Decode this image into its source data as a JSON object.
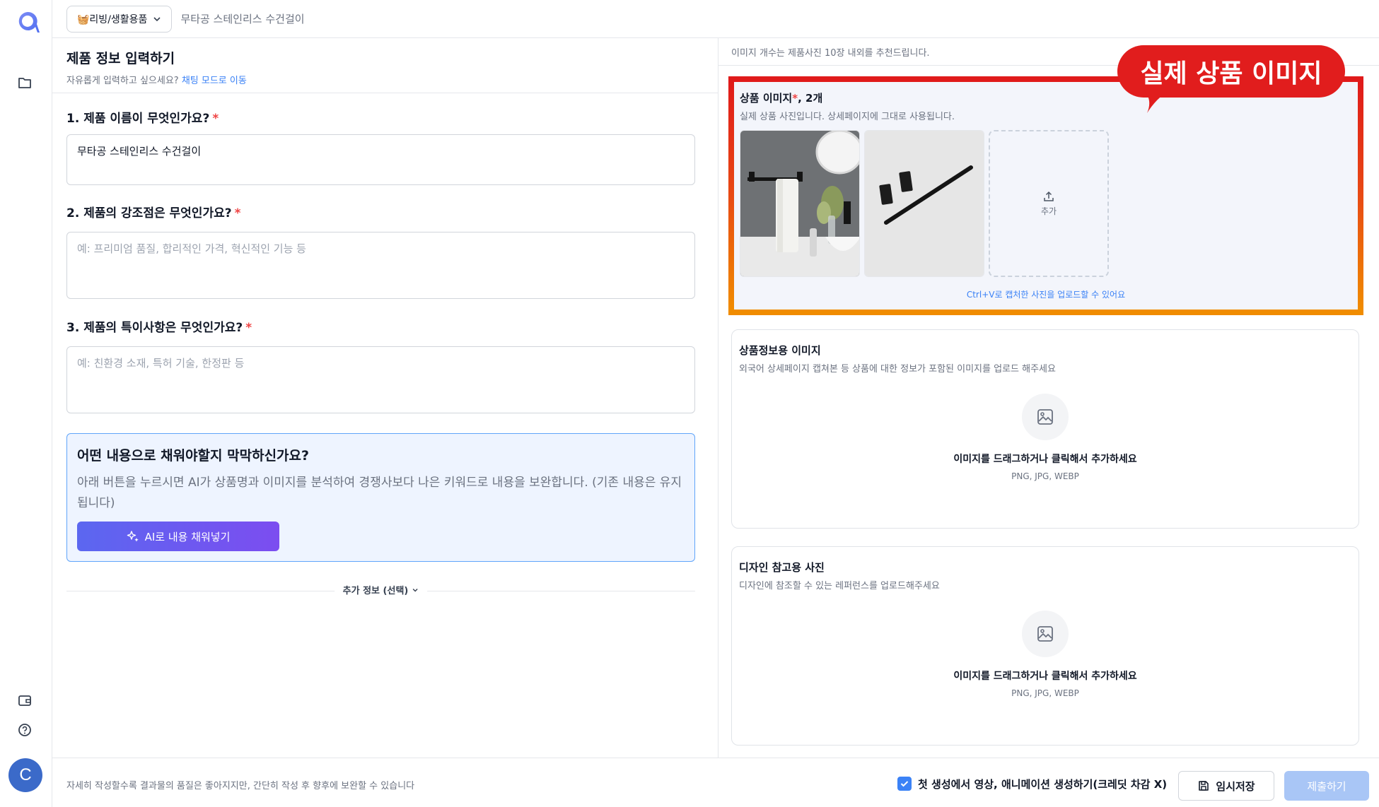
{
  "topbar": {
    "category_label": "🧺리빙/생활용품",
    "breadcrumb": "무타공 스테인리스 수건걸이"
  },
  "left": {
    "title": "제품 정보 입력하기",
    "subtitle_prefix": "자유롭게 입력하고 싶으세요?",
    "subtitle_link": "채팅 모드로 이동",
    "questions": [
      {
        "label": "1. 제품 이름이 무엇인가요?",
        "required": "*",
        "value": "무타공 스테인리스 수건걸이",
        "placeholder": ""
      },
      {
        "label": "2. 제품의 강조점은 무엇인가요?",
        "required": "*",
        "value": "",
        "placeholder": "예: 프리미엄 품질, 합리적인 가격, 혁신적인 기능 등"
      },
      {
        "label": "3. 제품의 특이사항은 무엇인가요?",
        "required": "*",
        "value": "",
        "placeholder": "예: 친환경 소재, 특허 기술, 한정판 등"
      }
    ],
    "ai_box": {
      "heading": "어떤 내용으로 채워야할지 막막하신가요?",
      "text": "아래 버튼을 누르시면 AI가 상품명과 이미지를 분석하여 경쟁사보다 나은 키워드로 내용을 보완합니다. (기존 내용은 유지됩니다)",
      "button": "AI로 내용 채워넣기"
    },
    "more_info": "추가 정보 (선택)"
  },
  "right": {
    "top_note": "이미지 개수는 제품사진 10장 내외를 추천드립니다.",
    "callout": "실제 상품 이미지",
    "product_images": {
      "title": "상품 이미지",
      "required": "*",
      "count": ", 2개",
      "subtitle": "실제 상품 사진입니다. 상세페이지에 그대로 사용됩니다.",
      "add_label": "추가",
      "hint": "Ctrl+V로 캡처한 사진을 업로드할 수 있어요"
    },
    "info_images": {
      "title": "상품정보용 이미지",
      "subtitle": "외국어 상세페이지 캡쳐본 등 상품에 대한 정보가 포함된 이미지를 업로드 해주세요",
      "drop_label": "이미지를 드래그하거나 클릭해서 추가하세요",
      "formats": "PNG, JPG, WEBP"
    },
    "design_images": {
      "title": "디자인 참고용 사진",
      "subtitle": "디자인에 참조할 수 있는 레퍼런스를 업로드해주세요",
      "drop_label": "이미지를 드래그하거나 클릭해서 추가하세요",
      "formats": "PNG, JPG, WEBP"
    }
  },
  "bottom": {
    "message": "자세히 작성할수록 결과물의 품질은 좋아지지만, 간단히 작성 후 향후에 보완할 수 있습니다",
    "checkbox_label": "첫 생성에서 영상, 애니메이션 생성하기(크레딧 차감 X)",
    "checkbox_checked": true,
    "save_label": "임시저장",
    "submit_label": "제출하기"
  },
  "user": {
    "avatar_initial": "C"
  },
  "colors": {
    "accent": "#3b82f6",
    "callout": "#e11d1d",
    "required": "#ef4444"
  }
}
